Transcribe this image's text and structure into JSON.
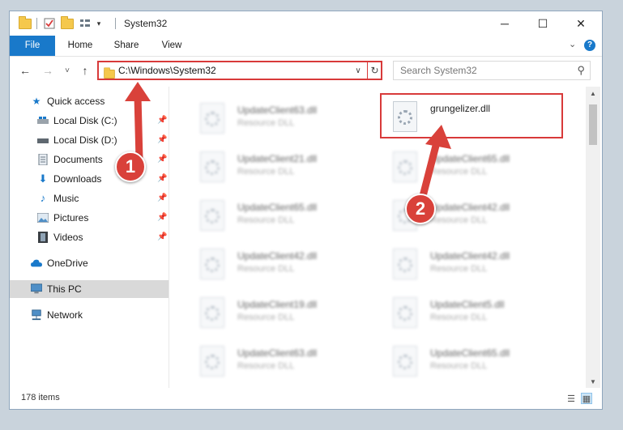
{
  "window": {
    "title": "System32",
    "controls": {
      "minimize": "─",
      "maximize": "☐",
      "close": "✕"
    }
  },
  "ribbon": {
    "tabs": [
      "File",
      "Home",
      "Share",
      "View"
    ],
    "expand_icon": "chevron-down-icon",
    "help_icon": "?"
  },
  "navbar": {
    "back": "←",
    "forward": "→",
    "recent": "˅",
    "up": "↑",
    "address": "C:\\Windows\\System32",
    "address_dropdown": "∨",
    "refresh": "↻",
    "search_placeholder": "Search System32"
  },
  "sidebar": {
    "items": [
      {
        "label": "Quick access",
        "icon": "star-icon",
        "pinned": false
      },
      {
        "label": "Local Disk (C:)",
        "icon": "drive-icon",
        "pinned": true
      },
      {
        "label": "Local Disk (D:)",
        "icon": "drive-icon",
        "pinned": true
      },
      {
        "label": "Documents",
        "icon": "documents-icon",
        "pinned": true
      },
      {
        "label": "Downloads",
        "icon": "download-icon",
        "pinned": true
      },
      {
        "label": "Music",
        "icon": "music-icon",
        "pinned": true
      },
      {
        "label": "Pictures",
        "icon": "pictures-icon",
        "pinned": true
      },
      {
        "label": "Videos",
        "icon": "video-icon",
        "pinned": true
      },
      {
        "label": "OneDrive",
        "icon": "cloud-icon",
        "pinned": false
      },
      {
        "label": "This PC",
        "icon": "computer-icon",
        "pinned": false,
        "selected": true
      },
      {
        "label": "Network",
        "icon": "network-icon",
        "pinned": false
      }
    ]
  },
  "files": {
    "highlighted": {
      "name": "grungelizer.dll"
    },
    "left_column": [
      {
        "name": "UpdateClient63.dll",
        "type": "Resource DLL"
      },
      {
        "name": "UpdateClient21.dll",
        "type": "Resource DLL"
      },
      {
        "name": "UpdateClient65.dll",
        "type": "Resource DLL"
      },
      {
        "name": "UpdateClient42.dll",
        "type": "Resource DLL"
      },
      {
        "name": "UpdateClient19.dll",
        "type": "Resource DLL"
      },
      {
        "name": "UpdateClient63.dll",
        "type": "Resource DLL"
      }
    ],
    "right_column": [
      {
        "name": "UpdateClient65.dll",
        "type": "Resource DLL"
      },
      {
        "name": "UpdateClient42.dll",
        "type": "Resource DLL"
      },
      {
        "name": "UpdateClient42.dll",
        "type": "Resource DLL"
      },
      {
        "name": "UpdateClient5.dll",
        "type": "Resource DLL"
      },
      {
        "name": "UpdateClient65.dll",
        "type": "Resource DLL"
      }
    ]
  },
  "status": {
    "item_count": "178 items"
  },
  "callouts": [
    "1",
    "2"
  ],
  "colors": {
    "accent": "#1979ca",
    "callout": "#d9413a",
    "highlight": "#d83a3a"
  }
}
